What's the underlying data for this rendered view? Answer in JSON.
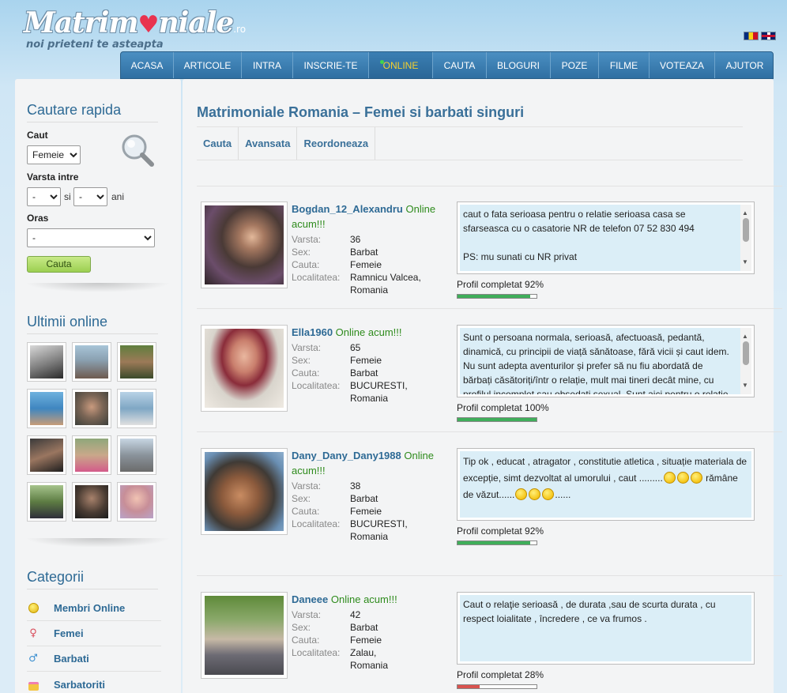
{
  "header": {
    "logo_text": "Matrimoniale",
    "logo_tld": ".ro",
    "tagline": "noi prieteni te asteapta",
    "flags": [
      "ro-flag",
      "en-flag"
    ]
  },
  "nav": [
    {
      "label": "ACASA"
    },
    {
      "label": "ARTICOLE"
    },
    {
      "label": "INTRA"
    },
    {
      "label": "INSCRIE-TE"
    },
    {
      "label": "ONLINE",
      "active": true
    },
    {
      "label": "CAUTA"
    },
    {
      "label": "BLOGURI"
    },
    {
      "label": "POZE"
    },
    {
      "label": "FILME"
    },
    {
      "label": "VOTEAZA"
    },
    {
      "label": "AJUTOR"
    }
  ],
  "sidebar": {
    "quick_search": {
      "title": "Cautare rapida",
      "caut_label": "Caut",
      "caut_value": "Femeie",
      "age_label": "Varsta intre",
      "age_from": "-",
      "age_and": "si",
      "age_to": "-",
      "age_unit": "ani",
      "city_label": "Oras",
      "city_value": "-",
      "button": "Cauta"
    },
    "online": {
      "title": "Ultimii online"
    },
    "categories": {
      "title": "Categorii",
      "items": [
        {
          "label": "Membri Online",
          "icon": "online-dot-icon"
        },
        {
          "label": "Femei",
          "icon": "female-icon"
        },
        {
          "label": "Barbati",
          "icon": "male-icon"
        },
        {
          "label": "Sarbatoriti",
          "icon": "cake-icon"
        }
      ]
    }
  },
  "main": {
    "title": "Matrimoniale Romania – Femei si barbati singuri",
    "tabs": [
      "Cauta",
      "Avansata",
      "Reordoneaza"
    ],
    "field_labels": {
      "age": "Varsta:",
      "sex": "Sex:",
      "seeking": "Cauta:",
      "city": "Localitatea:"
    },
    "profiles": [
      {
        "name": "Bogdan_12_Alexandru",
        "status": "Online acum!!!",
        "age": "36",
        "sex": "Barbat",
        "seeking": "Femeie",
        "city": "Ramnicu Valcea,",
        "country": "Romania",
        "description": "caut o fata serioasa pentru o relatie serioasa casa se sfarseasca cu o casatorie NR de telefon 07 52 830 494",
        "description2": "PS: mu sunati cu NR privat",
        "completion_label": "Profil completat 92%",
        "completion": 0.92,
        "bar_color": "#3fae5a"
      },
      {
        "name": "Ella1960",
        "status": "Online acum!!!",
        "age": "65",
        "sex": "Femeie",
        "seeking": "Barbat",
        "city": "BUCURESTI,",
        "country": "Romania",
        "description": "Sunt o persoana normala, serioasă, afectuoasă, pedantă, dinamică, cu principii de viață sănătoase, fără vicii și caut idem. Nu sunt adepta aventurilor și prefer să nu fiu abordată de bărbați căsătoriți/într o relație, mult mai tineri decât mine, cu profilul incomplet sau obsedati sexual. Sunt aici pentru o relatie de",
        "completion_label": "Profil completat 100%",
        "completion": 1.0,
        "bar_color": "#3fae5a"
      },
      {
        "name": "Dany_Dany_Dany1988",
        "status": "Online acum!!!",
        "age": "38",
        "sex": "Barbat",
        "seeking": "Femeie",
        "city": "BUCURESTI,",
        "country": "Romania",
        "description_a": "Tip ok , educat , atragator , constitutie atletica , situație materiala de excepție, simt dezvoltat al umorului , caut .........",
        "description_b": "rămâne de văzut......",
        "description_c": "......",
        "completion_label": "Profil completat 92%",
        "completion": 0.92,
        "bar_color": "#3fae5a"
      },
      {
        "name": "Daneee",
        "status": "Online acum!!!",
        "age": "42",
        "sex": "Barbat",
        "seeking": "Femeie",
        "city": "Zalau,",
        "country": "Romania",
        "description": "Caut o relaţie serioasă , de durata ,sau de scurta durata , cu respect loialitate , încredere , ce va frumos .",
        "completion_label": "Profil completat 28%",
        "completion": 0.28,
        "bar_color": "#d9534f"
      }
    ]
  }
}
